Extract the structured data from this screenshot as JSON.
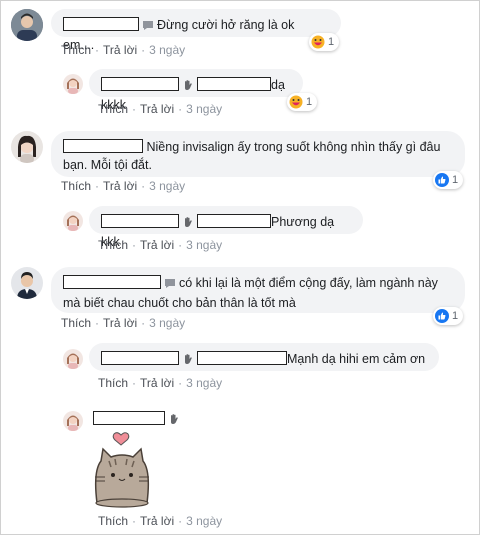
{
  "comments": [
    {
      "text": "Đừng cười hở răng là ok em....",
      "like": "Thích",
      "reply": "Trả lời",
      "time": "3 ngày",
      "reaction": {
        "type": "haha",
        "count": "1"
      }
    },
    {
      "text": "dạ kkkk",
      "like": "Thích",
      "reply": "Trả lời",
      "time": "3 ngày",
      "reaction": {
        "type": "haha",
        "count": "1"
      }
    },
    {
      "text_line1": "Niềng invisalign ấy trong suốt không nhìn thấy gì đâu",
      "text_line2": "bạn. Mỗi tội đắt.",
      "like": "Thích",
      "reply": "Trả lời",
      "time": "3 ngày",
      "reaction": {
        "type": "like",
        "count": "1"
      }
    },
    {
      "text": "Phương dạ kkk",
      "like": "Thích",
      "reply": "Trả lời",
      "time": "3 ngày"
    },
    {
      "text_line1": "có khi lại là một điểm cộng đấy, làm ngành này",
      "text_line2": "mà biết chau chuốt cho bản thân là tốt mà",
      "like": "Thích",
      "reply": "Trả lời",
      "time": "3 ngày",
      "reaction": {
        "type": "like",
        "count": "1"
      }
    },
    {
      "text": "Mạnh dạ hihi em cảm ơn",
      "like": "Thích",
      "reply": "Trả lời",
      "time": "3 ngày"
    },
    {
      "sticker": "pusheen-heart-sticker",
      "like": "Thích",
      "reply": "Trả lời",
      "time": "3 ngày"
    }
  ],
  "colors": {
    "like_blue": "#1877f2",
    "haha_yellow": "#f7b125",
    "bubble": "#f2f3f5",
    "meta_gray": "#8d949e"
  },
  "icons": {
    "mention": "mention-tag-icon",
    "wave": "wave-hand-icon",
    "haha": "haha-reaction-icon",
    "like": "like-reaction-icon"
  }
}
